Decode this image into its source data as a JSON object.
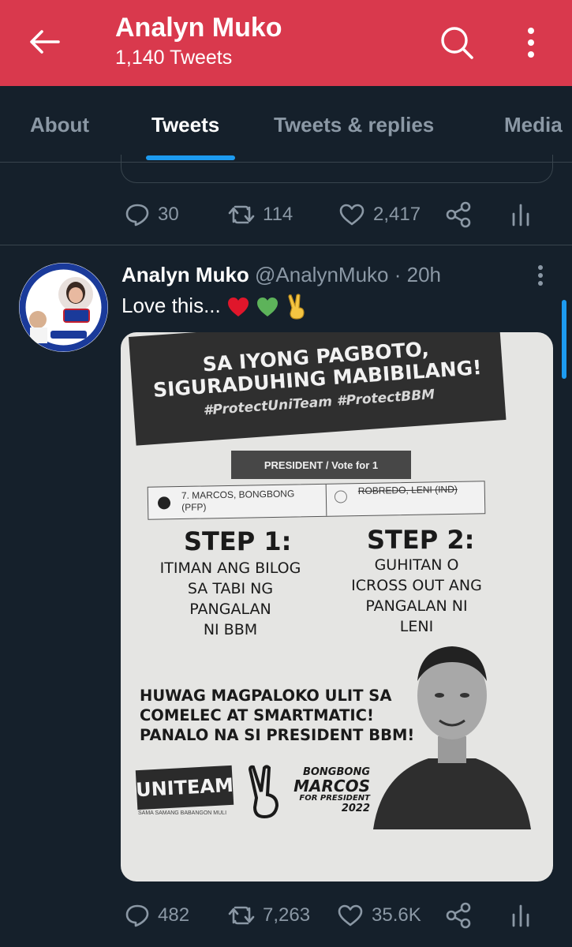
{
  "appbar": {
    "title": "Analyn Muko",
    "subtitle": "1,140 Tweets"
  },
  "tabs": [
    {
      "label": "About",
      "active": false
    },
    {
      "label": "Tweets",
      "active": true
    },
    {
      "label": "Tweets & replies",
      "active": false
    },
    {
      "label": "Media",
      "active": false
    }
  ],
  "prev_tweet": {
    "replies": "30",
    "retweets": "114",
    "likes": "2,417"
  },
  "tweet": {
    "name": "Analyn Muko",
    "handle": "@AnalynMuko",
    "time": "· 20h",
    "text": "Love this...",
    "emojis": [
      "red-heart",
      "green-heart",
      "victory-hand"
    ],
    "replies": "482",
    "retweets": "7,263",
    "likes": "35.6K",
    "flyer": {
      "banner_line1": "SA IYONG PAGBOTO,",
      "banner_line2": "SIGURADUHING MABIBILANG!",
      "banner_tags": "#ProtectUniTeam #ProtectBBM",
      "president_label": "PRESIDENT  /  Vote for 1",
      "candidate_line1": "7. MARCOS, BONGBONG",
      "candidate_line2": "(PFP)",
      "candidate_other": "ROBREDO, LENI (IND)",
      "step1_title": "STEP 1:",
      "step1_lines": [
        "ITIMAN ANG BILOG",
        "SA TABI NG",
        "PANGALAN",
        "NI BBM"
      ],
      "step2_title": "STEP 2:",
      "step2_lines": [
        "GUHITAN O",
        "ICROSS OUT ANG",
        "PANGALAN NI",
        "LENI"
      ],
      "warning_lines": [
        "HUWAG MAGPALOKO ULIT SA",
        "COMELEC AT SMARTMATIC!",
        "PANALO NA SI PRESIDENT BBM!"
      ],
      "uniteam": "UNITEAM",
      "uniteam_sub": "SAMA SAMANG BABANGON MULI",
      "bbm_line1": "BONGBONG",
      "bbm_line2": "MARCOS",
      "bbm_line3": "FOR PRESIDENT",
      "bbm_line4": "2022"
    }
  },
  "colors": {
    "appbar": "#d9394d",
    "background": "#15202b",
    "accent": "#1d9bf0",
    "muted": "#8b98a5",
    "divider": "#38444d"
  }
}
